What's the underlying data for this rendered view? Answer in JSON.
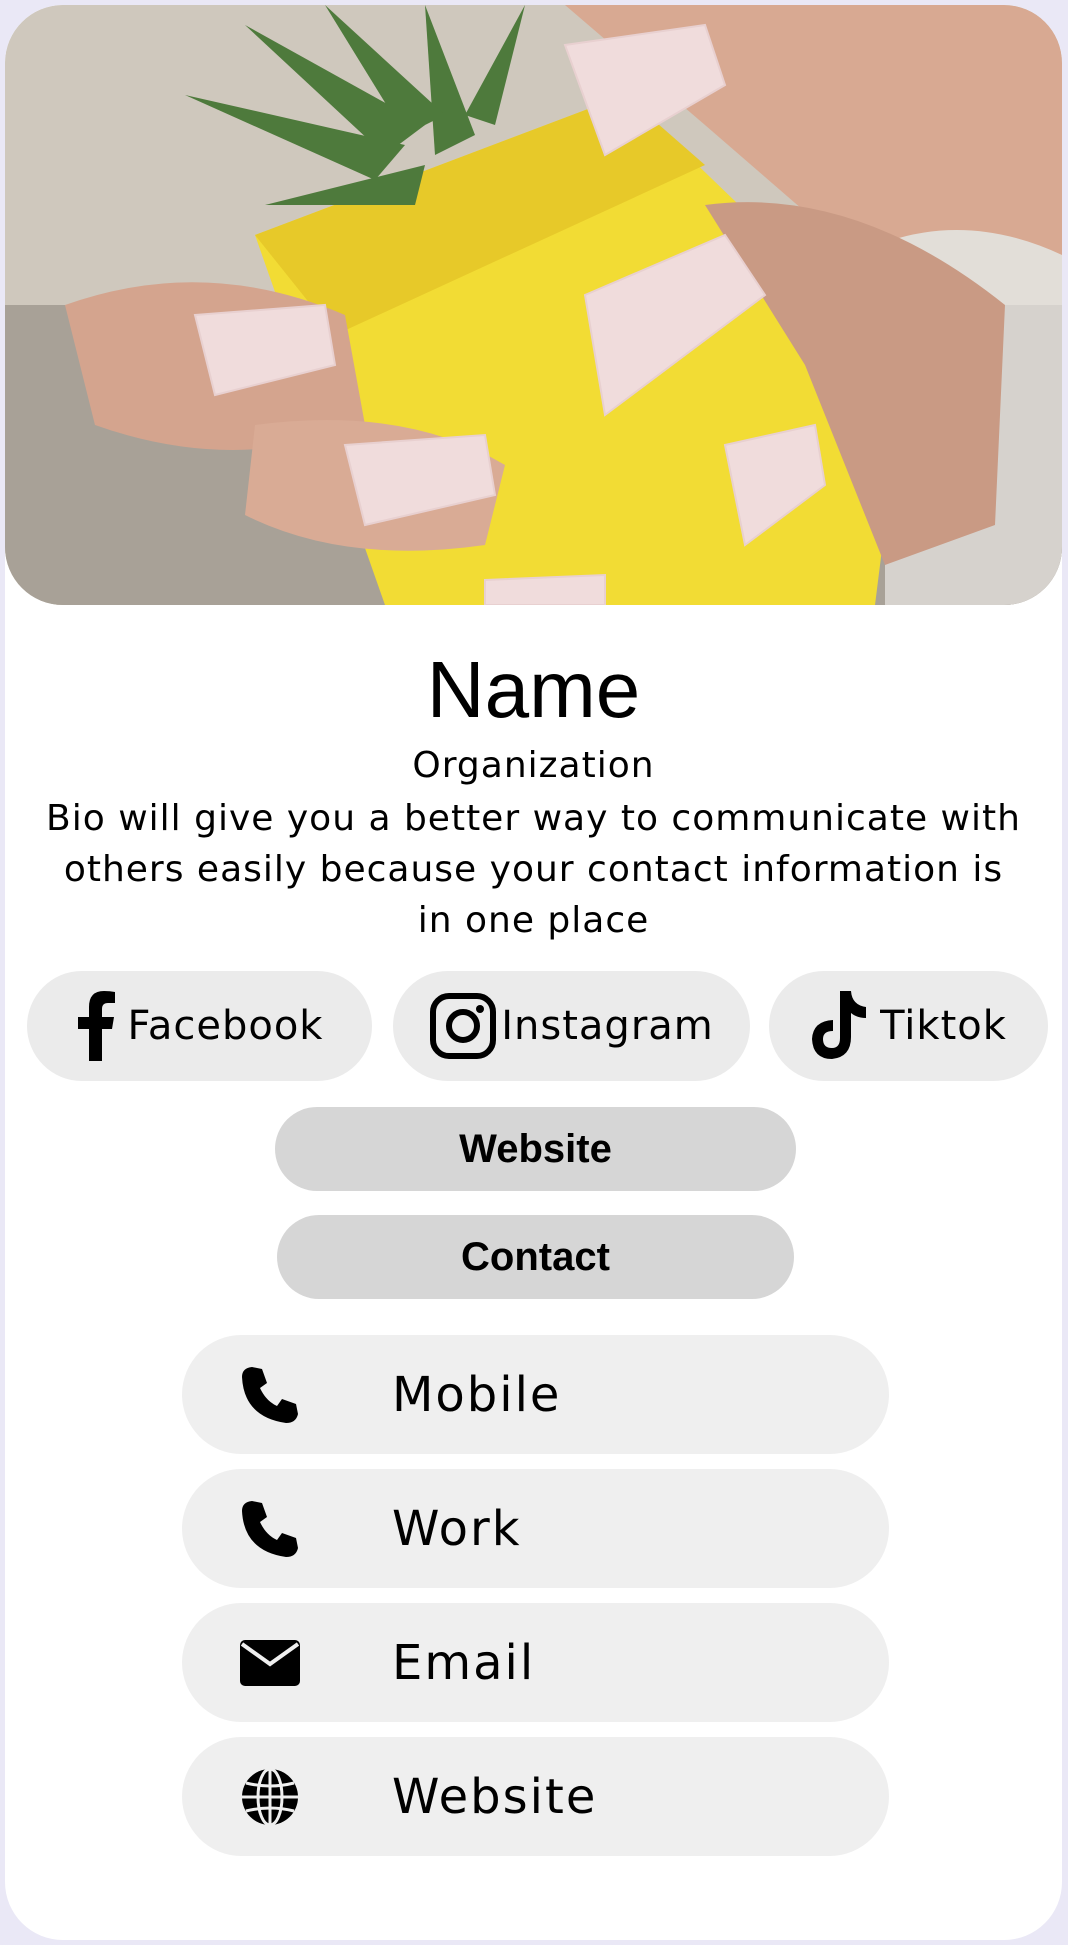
{
  "profile": {
    "name": "Name",
    "organization": "Organization",
    "bio": "Bio will give you a better way to communicate with others easily because your contact information is in one place"
  },
  "social": [
    {
      "label": "Facebook",
      "icon": "facebook-icon"
    },
    {
      "label": "Instagram",
      "icon": "instagram-icon"
    },
    {
      "label": "Tiktok",
      "icon": "tiktok-icon"
    }
  ],
  "actions": {
    "website_label": "Website",
    "contact_label": "Contact"
  },
  "contacts": [
    {
      "label": "Mobile",
      "icon": "phone-icon"
    },
    {
      "label": "Work",
      "icon": "phone-icon"
    },
    {
      "label": "Email",
      "icon": "envelope-icon"
    },
    {
      "label": "Website",
      "icon": "globe-icon"
    }
  ],
  "colors": {
    "page_background": "#eae8f6",
    "card_background": "#ffffff",
    "social_button": "#ebebeb",
    "pill_button": "#d6d6d6",
    "contact_row": "#efefef"
  }
}
